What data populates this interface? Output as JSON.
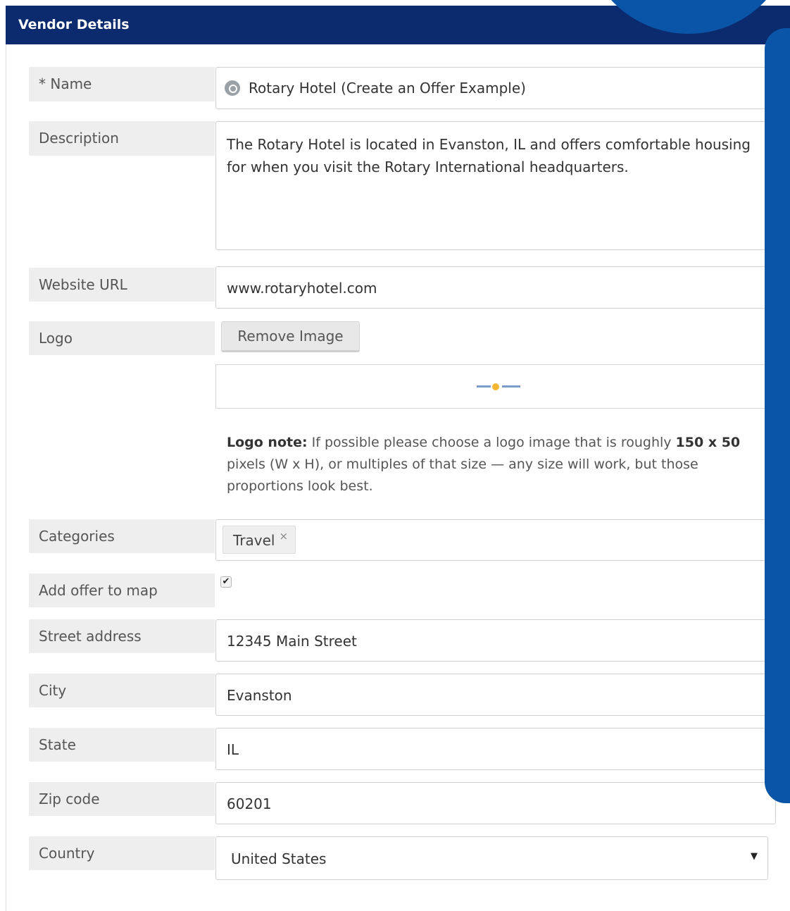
{
  "panel": {
    "title": "Vendor Details"
  },
  "fields": {
    "name": {
      "label": "* Name",
      "value": "Rotary Hotel (Create an Offer Example)",
      "icon": "search-icon"
    },
    "description": {
      "label": "Description",
      "value": "The Rotary Hotel is located in Evanston, IL and offers comfortable housing for when you visit the Rotary International headquarters."
    },
    "website": {
      "label": "Website URL",
      "value": "www.rotaryhotel.com"
    },
    "logo": {
      "label": "Logo",
      "remove_button": "Remove Image"
    },
    "logo_note": {
      "title": "Logo note:",
      "text_before": " If possible please choose a logo image that is roughly ",
      "bold_size": "150 x 50",
      "text_after": " pixels (W x H), or multiples of that size — any size will work, but those proportions look best."
    },
    "categories": {
      "label": "Categories",
      "tags": [
        {
          "text": "Travel",
          "remove": "×"
        }
      ]
    },
    "map": {
      "label": "Add offer to map",
      "checked": true,
      "check_glyph": "✔"
    },
    "street": {
      "label": "Street address",
      "value": "12345 Main Street"
    },
    "city": {
      "label": "City",
      "value": "Evanston"
    },
    "state": {
      "label": "State",
      "value": "IL"
    },
    "zip": {
      "label": "Zip code",
      "value": "60201"
    },
    "country": {
      "label": "Country",
      "value": "United States",
      "arrow": "▼"
    }
  },
  "colors": {
    "header_bg": "#0b2b6e",
    "accent": "#0b55a8",
    "label_bg": "#eeeeee"
  }
}
